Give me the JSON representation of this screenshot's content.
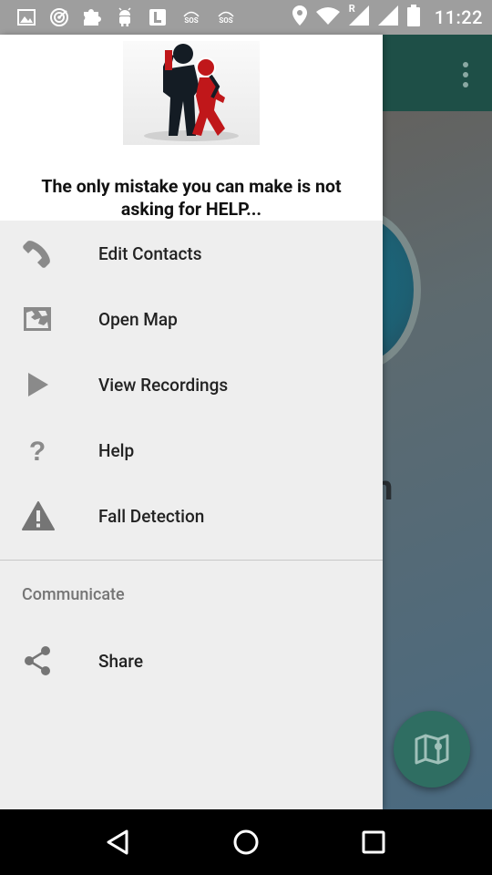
{
  "status_bar": {
    "time": "11:22",
    "sos1": "SOS",
    "sos2": "SOS",
    "roaming": "R"
  },
  "drawer": {
    "header": {
      "quote": "The only mistake you can make is not asking for HELP..."
    },
    "items": [
      {
        "label": "Edit Contacts",
        "icon": "phone-icon"
      },
      {
        "label": "Open Map",
        "icon": "map-icon"
      },
      {
        "label": "View Recordings",
        "icon": "play-icon"
      },
      {
        "label": "Help",
        "icon": "question-icon"
      },
      {
        "label": "Fall Detection",
        "icon": "warning-icon"
      }
    ],
    "section_title": "Communicate",
    "share": {
      "label": "Share",
      "icon": "share-icon"
    }
  },
  "background_app": {
    "partial_text": "n"
  },
  "colors": {
    "toolbar": "#1e4f47",
    "drawer_bg": "#eeeeee",
    "icon_gray": "#757575",
    "fab": "#2f6e62"
  }
}
